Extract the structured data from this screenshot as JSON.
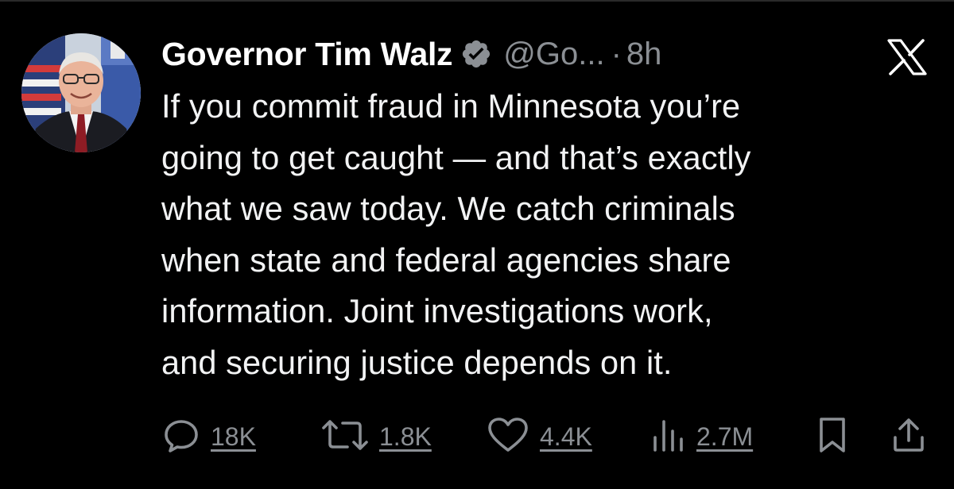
{
  "tweet": {
    "author": {
      "display_name": "Governor Tim Walz",
      "handle": "@Go...",
      "separator": "·",
      "time": "8h",
      "verified": true
    },
    "text_lines": [
      "If you commit fraud in Minnesota you’re",
      "going to get caught — and that’s exactly",
      "what we saw today. We catch criminals",
      "when state and federal agencies share",
      "information. Joint investigations work,",
      "and securing justice depends on it."
    ],
    "stats": {
      "replies": "18K",
      "reposts": "1.8K",
      "likes": "4.4K",
      "views": "2.7M"
    }
  },
  "icons": {
    "verified": "verified-badge-icon",
    "platform": "x-logo-icon",
    "reply": "reply-bubble-icon",
    "repost": "repost-arrows-icon",
    "like": "heart-icon",
    "views": "bar-chart-icon",
    "bookmark": "bookmark-icon",
    "share": "share-upload-icon"
  },
  "colors": {
    "background": "#000000",
    "text_primary": "#f2f3f4",
    "text_secondary": "#8b8f94",
    "badge": "#8b8f94"
  }
}
